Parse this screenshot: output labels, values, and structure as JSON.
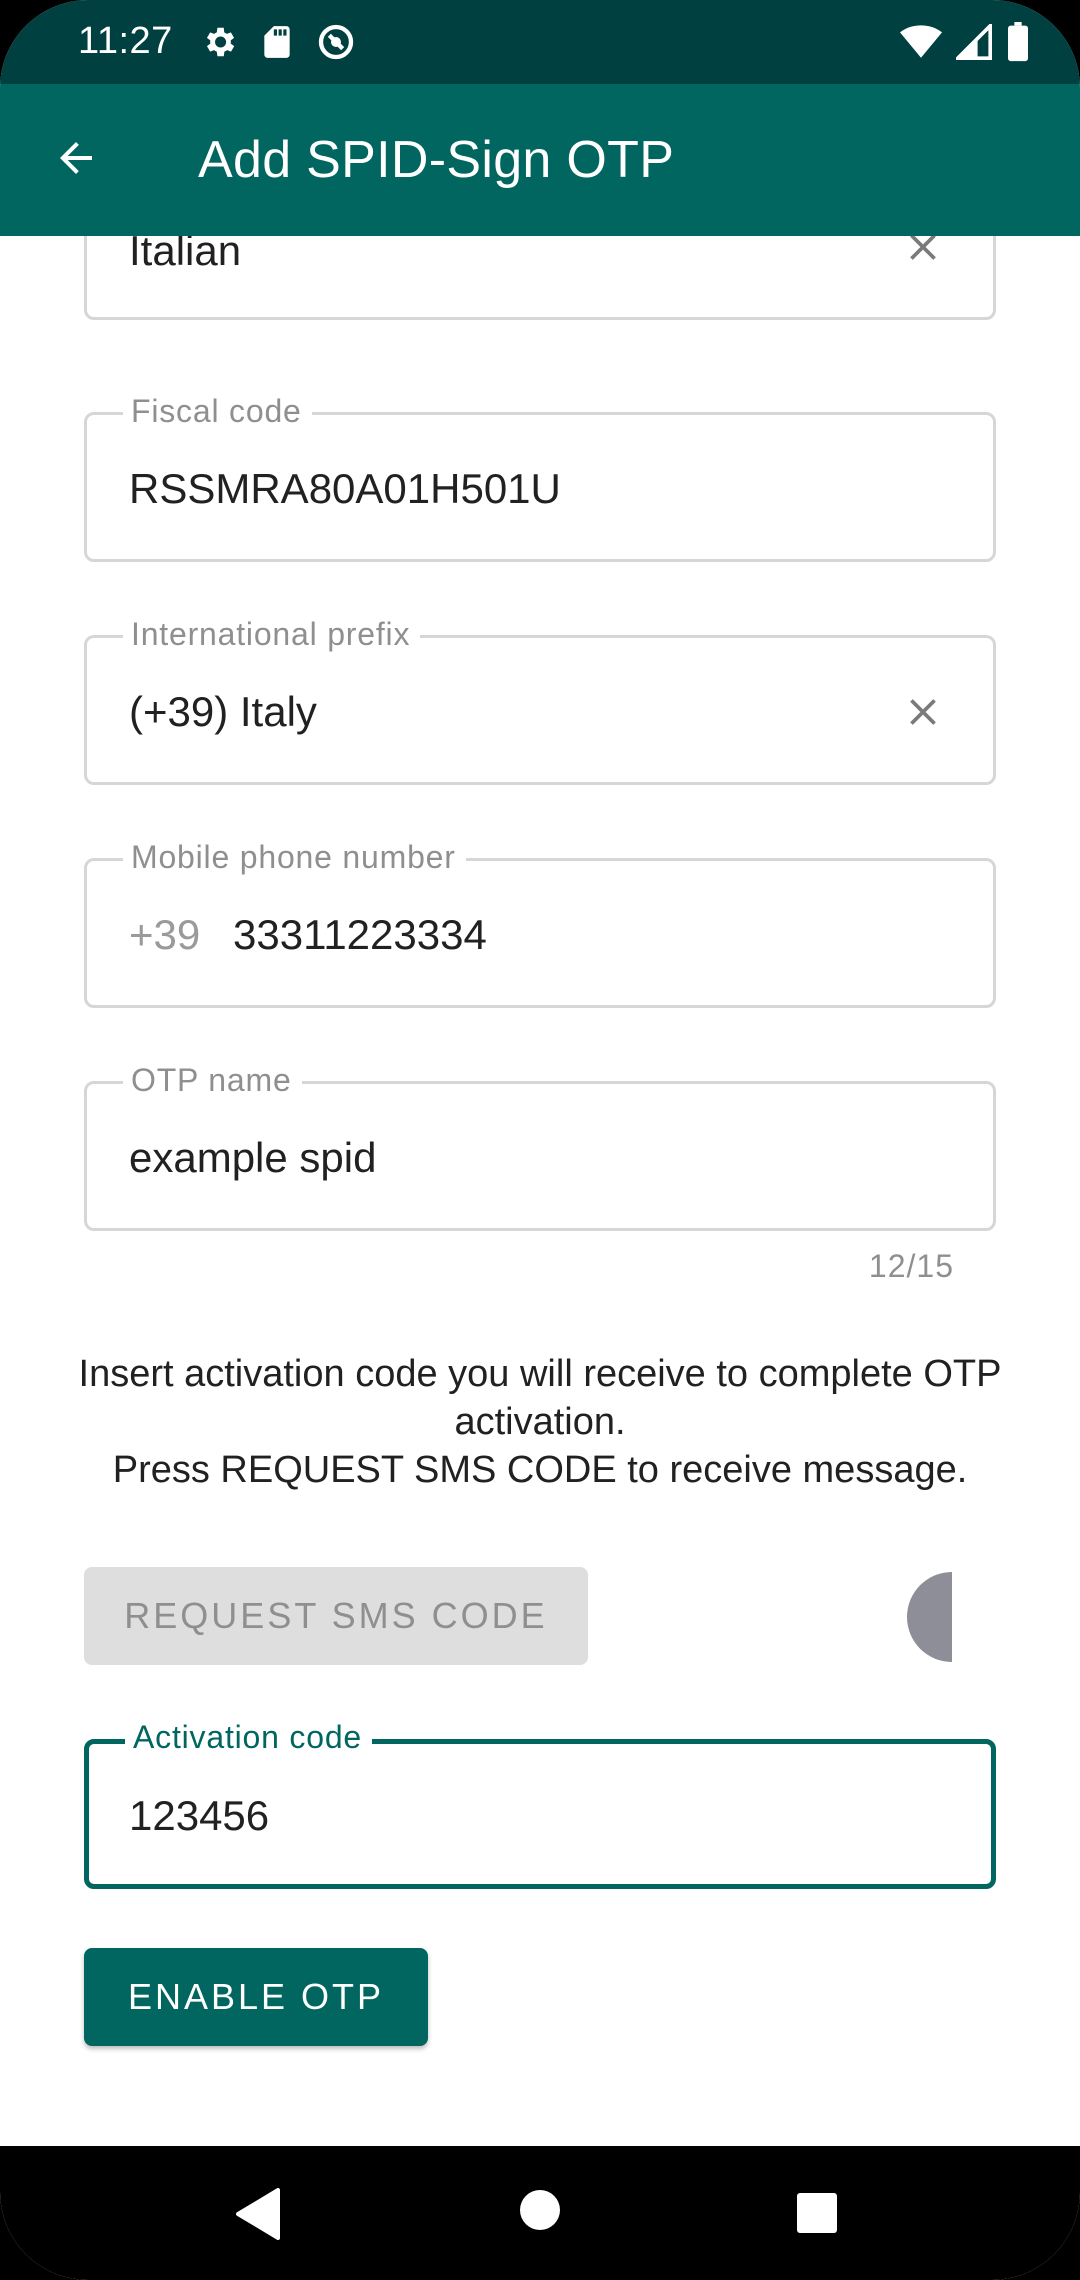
{
  "status_bar": {
    "time": "11:27",
    "left_icons": [
      "settings-icon",
      "sd-card-icon",
      "sync-icon"
    ],
    "right_icons": [
      "wifi-icon",
      "signal-icon",
      "battery-icon"
    ]
  },
  "app_bar": {
    "title": "Add SPID-Sign OTP",
    "back_icon": "arrow-back-icon"
  },
  "form": {
    "nationality": {
      "value": "Italian",
      "clear_icon": "close-icon"
    },
    "fiscal_code": {
      "label": "Fiscal code",
      "value": "RSSMRA80A01H501U"
    },
    "international_prefix": {
      "label": "International prefix",
      "value": "(+39) Italy",
      "clear_icon": "close-icon"
    },
    "mobile_phone": {
      "label": "Mobile phone number",
      "prefix": "+39",
      "value": "33311223334"
    },
    "otp_name": {
      "label": "OTP name",
      "value": "example spid",
      "counter": "12/15"
    },
    "info_text": "Insert activation code you will receive to complete OTP activation.\nPress REQUEST SMS CODE to receive message.",
    "request_button": {
      "label": "REQUEST SMS CODE",
      "enabled": false
    },
    "activation_code": {
      "label": "Activation code",
      "value": "123456",
      "focused": true
    },
    "enable_button": {
      "label": "ENABLE OTP"
    }
  },
  "nav_bar": {
    "icons": [
      "nav-back-icon",
      "nav-home-icon",
      "nav-recents-icon"
    ]
  },
  "colors": {
    "status_bar": "#004040",
    "primary": "#00665f",
    "disabled_button": "#dedede",
    "outline": "#d6d6d6",
    "hint_text": "#8f8f8f",
    "spinner": "#8e8e98"
  }
}
